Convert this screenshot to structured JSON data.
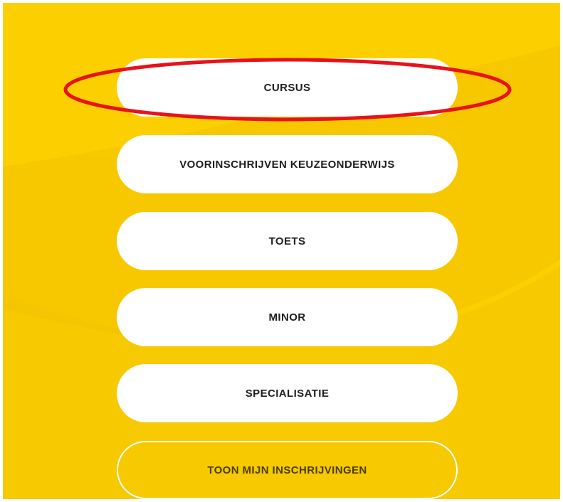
{
  "colors": {
    "background": "#fcd000",
    "wave_shade": "#f3c300",
    "button_fill": "#ffffff",
    "button_text": "#1e1e1e",
    "outline_text": "#4b3b00",
    "annotation": "#e8121a"
  },
  "menu": {
    "buttons": [
      {
        "label": "CURSUS"
      },
      {
        "label": "VOORINSCHRIJVEN KEUZEONDERWIJS"
      },
      {
        "label": "TOETS"
      },
      {
        "label": "MINOR"
      },
      {
        "label": "SPECIALISATIE"
      }
    ],
    "show_registrations_label": "TOON MIJN INSCHRIJVINGEN"
  }
}
